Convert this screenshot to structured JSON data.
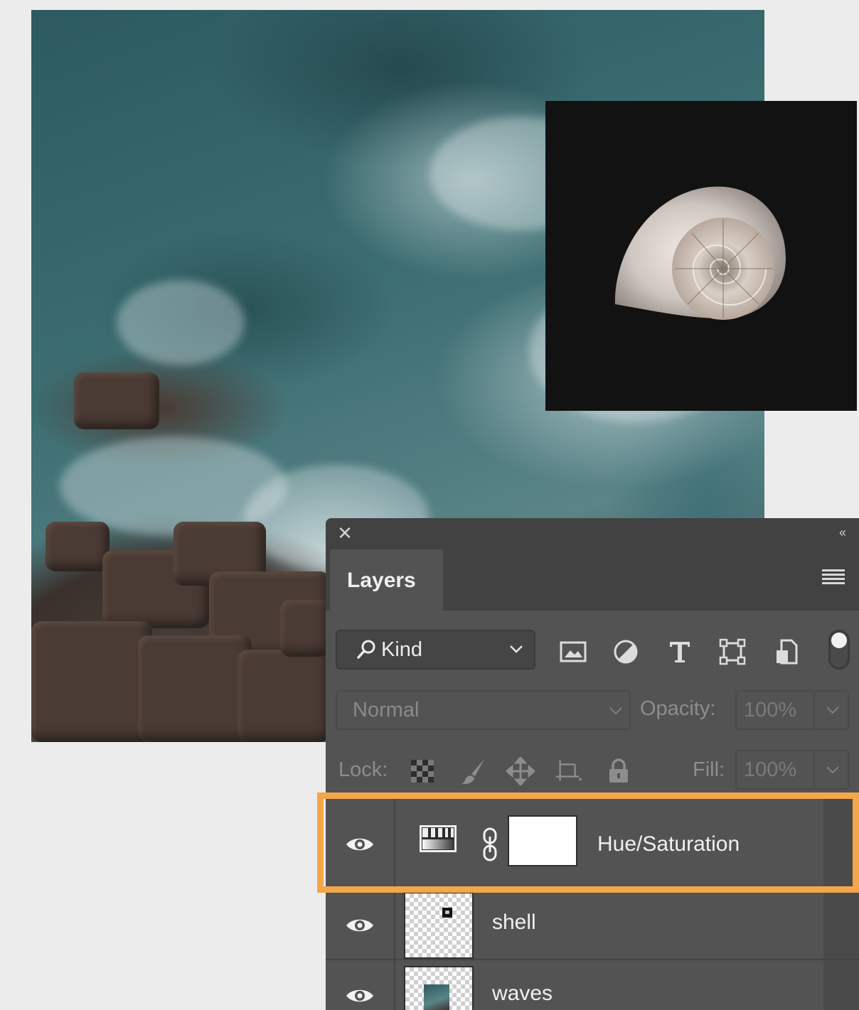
{
  "panel": {
    "close_glyph": "✕",
    "collapse_glyph": "‹‹",
    "tab_label": "Layers"
  },
  "filter": {
    "kind_label": "Kind",
    "icons": [
      "image-filter-icon",
      "adjustment-filter-icon",
      "type-filter-icon",
      "shape-filter-icon",
      "smart-object-filter-icon"
    ]
  },
  "blend": {
    "mode": "Normal",
    "opacity_label": "Opacity:",
    "opacity_value": "100%"
  },
  "lock": {
    "label": "Lock:",
    "fill_label": "Fill:",
    "fill_value": "100%",
    "icons": [
      "lock-transparent-pixels-icon",
      "lock-image-pixels-icon",
      "lock-position-icon",
      "lock-artboard-icon",
      "lock-all-icon"
    ]
  },
  "layers": [
    {
      "name": "Hue/Saturation",
      "type": "adjustment",
      "visible": true,
      "selected": true
    },
    {
      "name": "shell",
      "type": "pixel",
      "visible": true,
      "selected": false
    },
    {
      "name": "waves",
      "type": "pixel",
      "visible": true,
      "selected": false
    }
  ],
  "colors": {
    "highlight": "#f4a64a",
    "panel_bg": "#535353",
    "panel_header": "#424242",
    "canvas_bg": "#ececec"
  }
}
